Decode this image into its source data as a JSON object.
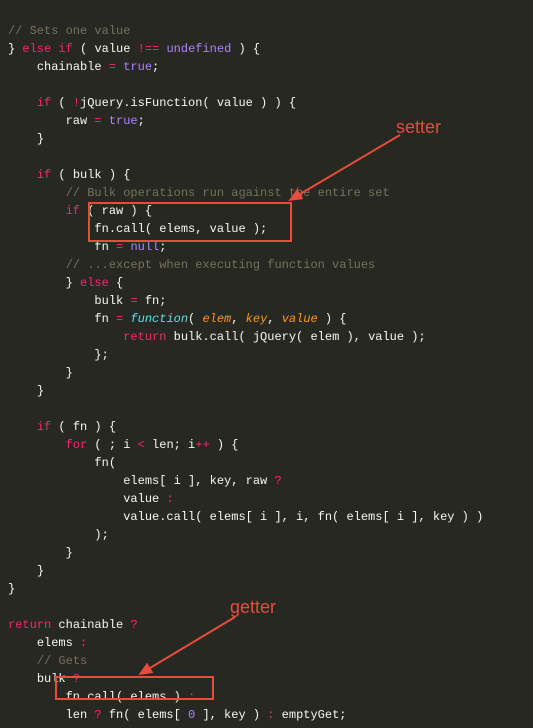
{
  "annotation_setter": "setter",
  "annotation_getter": "getter",
  "c1": "// Sets one value",
  "l2_else": "else if",
  "l2_value": "value",
  "l2_neq": "!==",
  "l2_undef": "undefined",
  "l3_chainable": "chainable",
  "l3_eq": "=",
  "l3_true": "true",
  "l5_if": "if",
  "l5_jq": "jQuery.isFunction( value ) ) {",
  "l6_raw": "raw",
  "l6_eq": "=",
  "l6_true": "true",
  "l7_rb": "}",
  "l9_if": "if",
  "l9_bulk": "( bulk ) {",
  "c10": "// Bulk operations run against the entire set",
  "l11_if": "if",
  "l11_raw": "( raw ) {",
  "l12": "fn.call( elems, value );",
  "l13_fn": "fn",
  "l13_eq": "=",
  "l13_null": "null",
  "c14": "// ...except when executing function values",
  "l15_else": "else",
  "l15_brace": " {",
  "l16_bulk": "bulk",
  "l16_eq": "=",
  "l16_fn": "fn;",
  "l17_fn": "fn",
  "l17_eq": "=",
  "l17_func": "function",
  "l17_p1": "elem",
  "l17_p2": "key",
  "l17_p3": "value",
  "l18_ret": "return",
  "l18_rest": " bulk.call( jQuery( elem ), value );",
  "l19": "};",
  "l20": "}",
  "l21": "}",
  "l23_if": "if",
  "l23_fn": "( fn ) {",
  "l24_for": "for",
  "l24_cond1": " ( ; i ",
  "l24_lt": "<",
  "l24_cond2": " len; i",
  "l24_pp": "++",
  "l24_cond3": " ) {",
  "l25": "fn(",
  "l26": "elems[ i ], key, raw ",
  "l26_q": "?",
  "l27": "value ",
  "l27_c": ":",
  "l28": "value.call( elems[ i ], i, fn( elems[ i ], key ) )",
  "l29": ");",
  "l30": "}",
  "l31": "}",
  "l32": "}",
  "l34_ret": "return",
  "l34_chain": " chainable ",
  "l34_q": "?",
  "l35": "elems ",
  "l35_c": ":",
  "c36": "// Gets",
  "l37": "bulk ",
  "l37_q": "?",
  "l38": "fn.call( elems ) ",
  "l38_c": ":",
  "l39_len": "len ",
  "l39_q": "?",
  "l39_fn": " fn( elems[ ",
  "l39_zero": "0",
  "l39_rest": " ], key ) ",
  "l39_c": ":",
  "l39_empty": " emptyGet;"
}
